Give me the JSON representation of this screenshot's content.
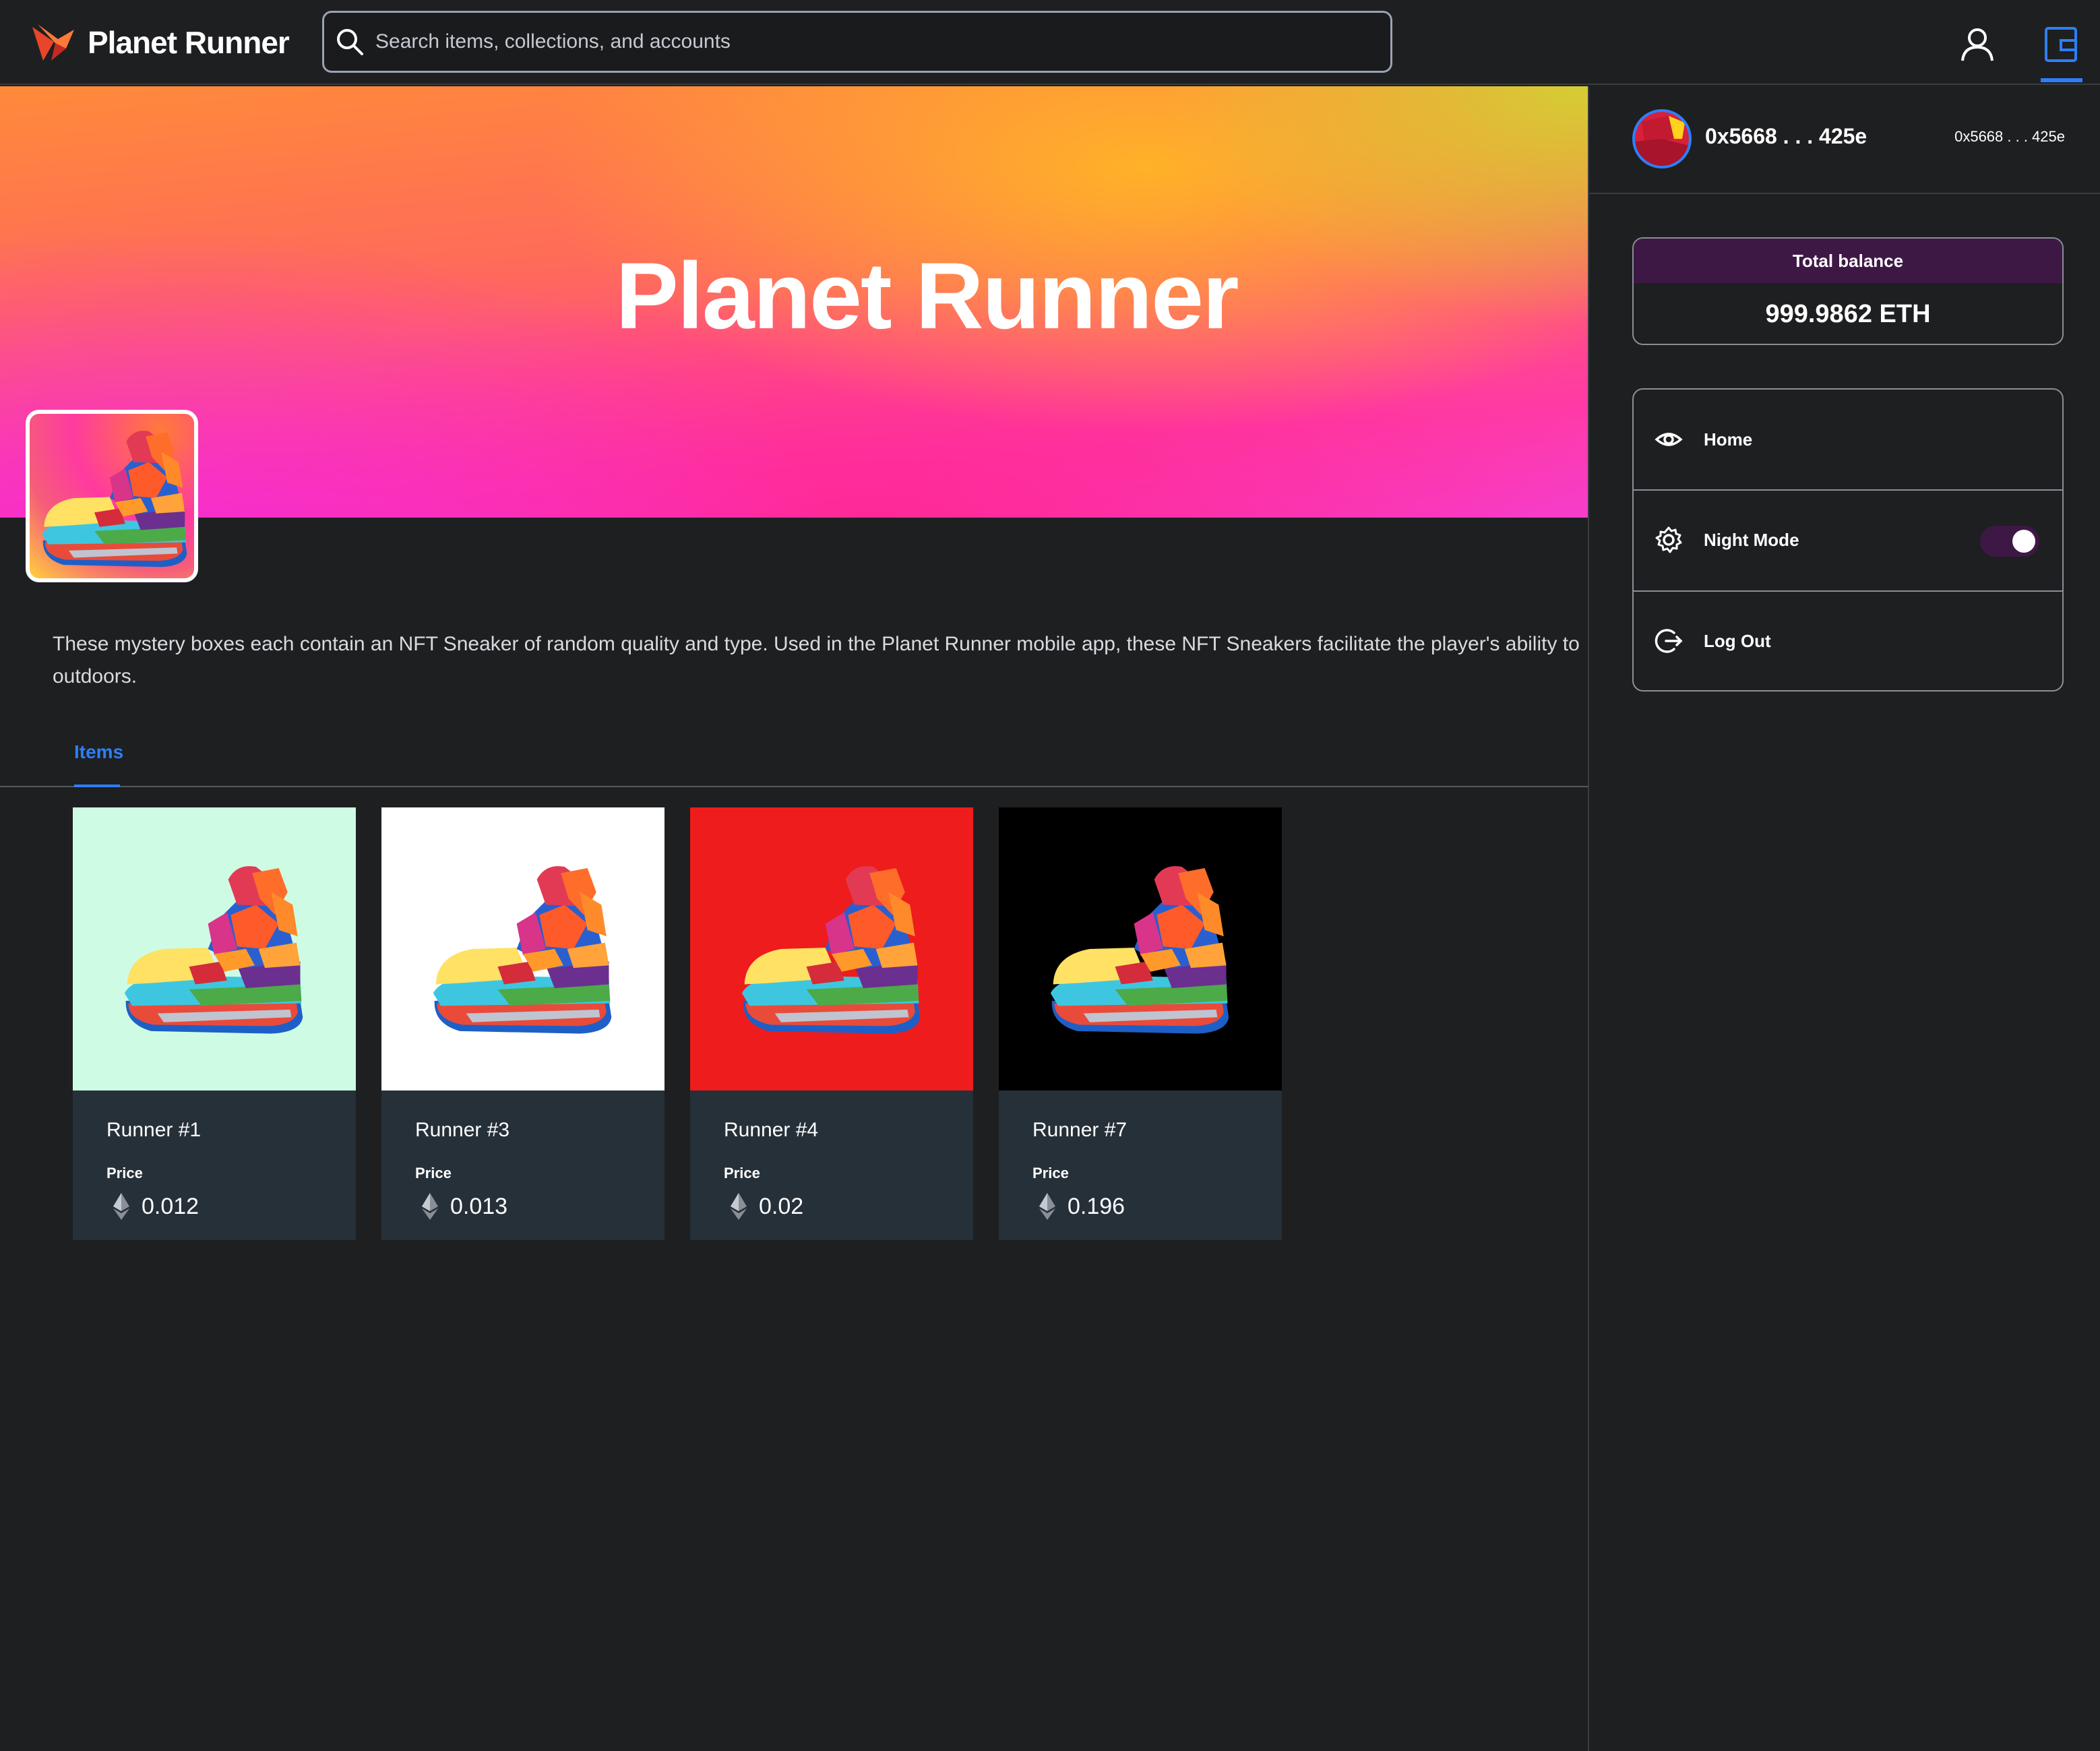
{
  "header": {
    "brand_name": "Planet Runner",
    "search_placeholder": "Search items, collections, and accounts",
    "icons": [
      "planet-runner-logo-icon",
      "search-icon",
      "user-icon",
      "wallet-icon"
    ],
    "accent_color": "#2d7ff9"
  },
  "collection": {
    "title": "Planet Runner",
    "description_line1": "These mystery boxes each contain an NFT Sneaker of random quality and type. Used in the Planet Runner mobile app, these NFT Sneakers facilitate the player's ability to",
    "description_line2": "outdoors."
  },
  "tabs": [
    {
      "label": "Items",
      "active": true
    }
  ],
  "items": [
    {
      "name": "Runner #1",
      "price_label": "Price",
      "price": "0.012",
      "background": "#cefbe4"
    },
    {
      "name": "Runner #3",
      "price_label": "Price",
      "price": "0.013",
      "background": "#ffffff"
    },
    {
      "name": "Runner #4",
      "price_label": "Price",
      "price": "0.02",
      "background": "#ee1c1c"
    },
    {
      "name": "Runner #7",
      "price_label": "Price",
      "price": "0.196",
      "background": "#000000"
    }
  ],
  "wallet": {
    "address": "0x5668 . . . 425e",
    "address_small": "0x5668 . . . 425e",
    "balance_label": "Total balance",
    "balance_value": "999.9862 ETH",
    "menu": [
      {
        "label": "Home",
        "icon": "eye-icon"
      },
      {
        "label": "Night Mode",
        "icon": "gear-icon",
        "toggle_on": true
      },
      {
        "label": "Log Out",
        "icon": "logout-icon"
      }
    ],
    "toggle_color": "#3e1845"
  }
}
